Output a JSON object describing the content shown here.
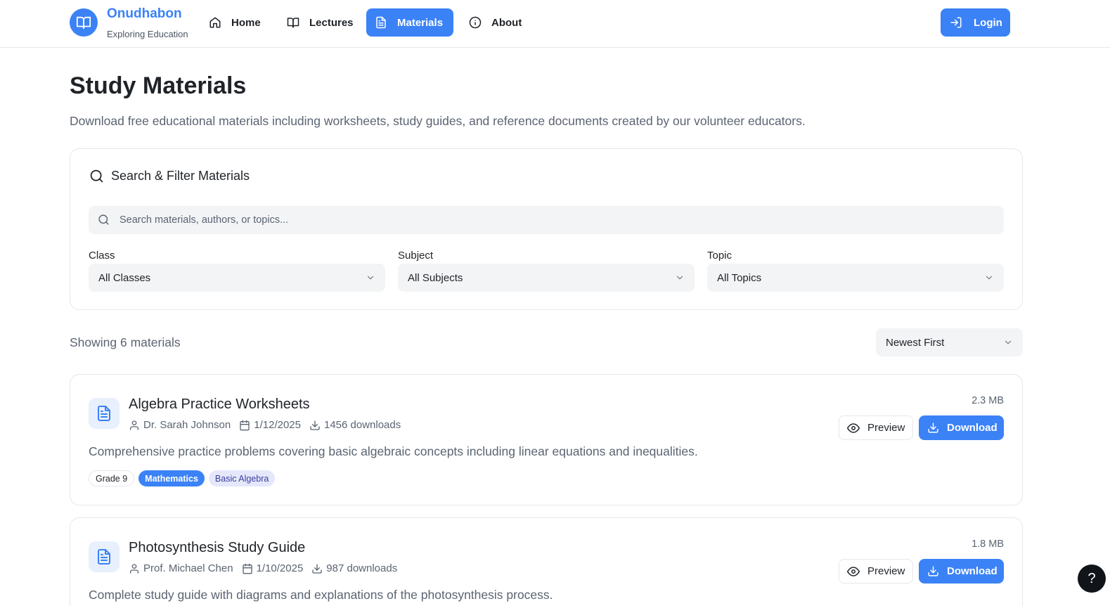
{
  "brand": {
    "name": "Onudhabon",
    "tagline": "Exploring Education"
  },
  "nav": {
    "items": [
      {
        "label": "Home",
        "icon": "home-icon"
      },
      {
        "label": "Lectures",
        "icon": "book-open-icon"
      },
      {
        "label": "Materials",
        "icon": "file-text-icon",
        "active": true
      },
      {
        "label": "About",
        "icon": "info-icon"
      }
    ],
    "login_label": "Login"
  },
  "header": {
    "title": "Study Materials",
    "description": "Download free educational materials including worksheets, study guides, and reference documents created by our volunteer educators."
  },
  "filters": {
    "heading": "Search & Filter Materials",
    "search_placeholder": "Search materials, authors, or topics...",
    "search_value": "",
    "class": {
      "label": "Class",
      "value": "All Classes"
    },
    "subject": {
      "label": "Subject",
      "value": "All Subjects"
    },
    "topic": {
      "label": "Topic",
      "value": "All Topics"
    }
  },
  "results": {
    "count_text": "Showing 6 materials",
    "sort_value": "Newest First"
  },
  "materials": [
    {
      "title": "Algebra Practice Worksheets",
      "author": "Dr. Sarah Johnson",
      "date": "1/12/2025",
      "downloads": "1456 downloads",
      "description": "Comprehensive practice problems covering basic algebraic concepts including linear equations and inequalities.",
      "size": "2.3 MB",
      "tags": {
        "grade": "Grade 9",
        "subject": "Mathematics",
        "topic": "Basic Algebra"
      },
      "preview_label": "Preview",
      "download_label": "Download"
    },
    {
      "title": "Photosynthesis Study Guide",
      "author": "Prof. Michael Chen",
      "date": "1/10/2025",
      "downloads": "987 downloads",
      "description": "Complete study guide with diagrams and explanations of the photosynthesis process.",
      "size": "1.8 MB",
      "preview_label": "Preview",
      "download_label": "Download"
    }
  ],
  "help": {
    "label": "?"
  },
  "colors": {
    "primary": "#3b82f6",
    "muted_text": "#5b6472",
    "border": "#e5e7eb",
    "input_bg": "#f3f4f6"
  }
}
